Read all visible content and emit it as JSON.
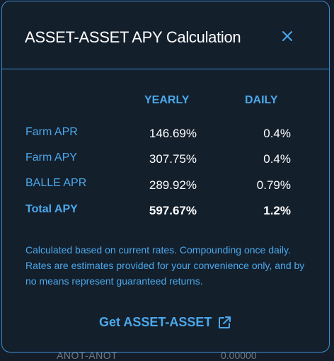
{
  "modal": {
    "title": "ASSET-ASSET APY Calculation",
    "close_icon": "close-icon",
    "columns": {
      "yearly": "YEARLY",
      "daily": "DAILY"
    },
    "rows": [
      {
        "label": "Farm APR",
        "yearly": "146.69%",
        "daily": "0.4%"
      },
      {
        "label": "Farm APY",
        "yearly": "307.75%",
        "daily": "0.4%"
      },
      {
        "label": "BALLE APR",
        "yearly": "289.92%",
        "daily": "0.79%"
      },
      {
        "label": "Total APY",
        "yearly": "597.67%",
        "daily": "1.2%"
      }
    ],
    "note": "Calculated based on current rates. Compounding once daily. Rates are estimates provided for your convenience only, and by no means represent guaranteed returns.",
    "link_label": "Get ASSET-ASSET",
    "link_icon": "external-link-icon"
  },
  "colors": {
    "accent": "#4aa8ea",
    "border": "#3b8fd6",
    "modal_bg": "#141f2c",
    "text": "#ffffff"
  }
}
